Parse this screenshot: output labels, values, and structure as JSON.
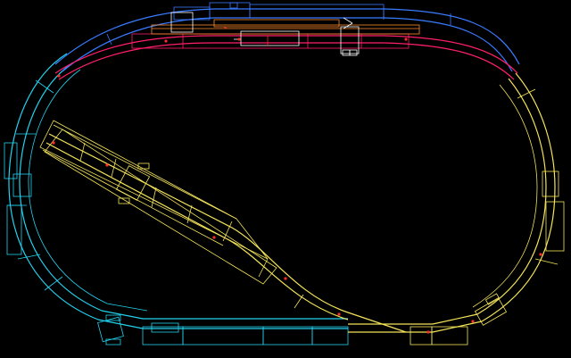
{
  "canvas": {
    "background": "#000000"
  },
  "colors": {
    "blue": "#3a7bff",
    "magenta": "#ff1f6a",
    "cyan": "#22d3f0",
    "yellow": "#f4e45a",
    "orange": "#ff8a2a",
    "white": "#ffffff",
    "red": "#ff2a2a"
  },
  "track_sections": [
    {
      "id": "top-outer",
      "color_key": "blue"
    },
    {
      "id": "top-inner",
      "color_key": "magenta"
    },
    {
      "id": "left-curve",
      "color_key": "cyan"
    },
    {
      "id": "right-curve",
      "color_key": "yellow"
    },
    {
      "id": "siding",
      "color_key": "yellow"
    },
    {
      "id": "station",
      "color_key": "orange"
    }
  ]
}
